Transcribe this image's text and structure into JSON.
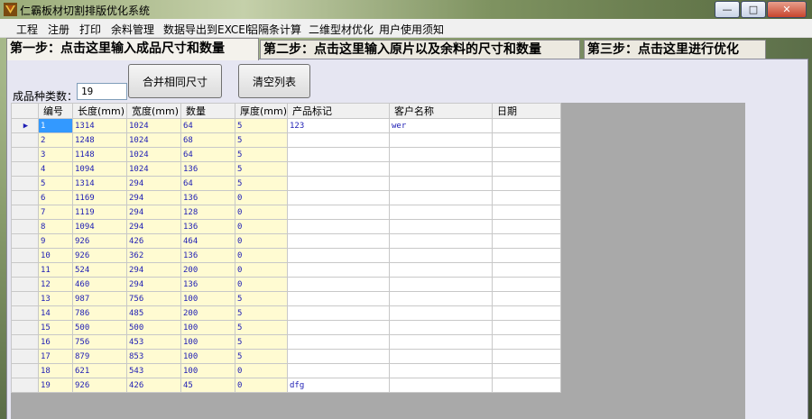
{
  "window": {
    "title": "仁霸板材切割排版优化系统"
  },
  "menu": [
    "工程",
    "注册",
    "打印",
    "余料管理",
    "数据导出到EXCEl",
    "铝隔条计算",
    "二维型材优化",
    "用户使用须知"
  ],
  "tabs": [
    "第一步：点击这里输入成品尺寸和数量",
    "第二步：点击这里输入原片以及余料的尺寸和数量",
    "第三步：点击这里进行优化"
  ],
  "buttons": {
    "merge": "合并相同尺寸",
    "clear": "清空列表"
  },
  "count": {
    "label": "成品种类数：",
    "value": "19"
  },
  "table": {
    "columns": [
      "编号",
      "长度(mm)",
      "宽度(mm)",
      "数量",
      "厚度(mm)",
      "产品标记",
      "客户名称",
      "日期"
    ],
    "current_row_marker": "▶",
    "rows": [
      [
        "1",
        "1314",
        "1024",
        "64",
        "5",
        "123",
        "wer",
        ""
      ],
      [
        "2",
        "1248",
        "1024",
        "68",
        "5",
        "",
        "",
        ""
      ],
      [
        "3",
        "1148",
        "1024",
        "64",
        "5",
        "",
        "",
        ""
      ],
      [
        "4",
        "1094",
        "1024",
        "136",
        "5",
        "",
        "",
        ""
      ],
      [
        "5",
        "1314",
        "294",
        "64",
        "5",
        "",
        "",
        ""
      ],
      [
        "6",
        "1169",
        "294",
        "136",
        "0",
        "",
        "",
        ""
      ],
      [
        "7",
        "1119",
        "294",
        "128",
        "0",
        "",
        "",
        ""
      ],
      [
        "8",
        "1094",
        "294",
        "136",
        "0",
        "",
        "",
        ""
      ],
      [
        "9",
        "926",
        "426",
        "464",
        "0",
        "",
        "",
        ""
      ],
      [
        "10",
        "926",
        "362",
        "136",
        "0",
        "",
        "",
        ""
      ],
      [
        "11",
        "524",
        "294",
        "200",
        "0",
        "",
        "",
        ""
      ],
      [
        "12",
        "460",
        "294",
        "136",
        "0",
        "",
        "",
        ""
      ],
      [
        "13",
        "987",
        "756",
        "100",
        "5",
        "",
        "",
        ""
      ],
      [
        "14",
        "786",
        "485",
        "200",
        "5",
        "",
        "",
        ""
      ],
      [
        "15",
        "500",
        "500",
        "100",
        "5",
        "",
        "",
        ""
      ],
      [
        "16",
        "756",
        "453",
        "100",
        "5",
        "",
        "",
        ""
      ],
      [
        "17",
        "879",
        "853",
        "100",
        "5",
        "",
        "",
        ""
      ],
      [
        "18",
        "621",
        "543",
        "100",
        "0",
        "",
        "",
        ""
      ],
      [
        "19",
        "926",
        "426",
        "45",
        "0",
        "dfg",
        "",
        ""
      ]
    ]
  }
}
